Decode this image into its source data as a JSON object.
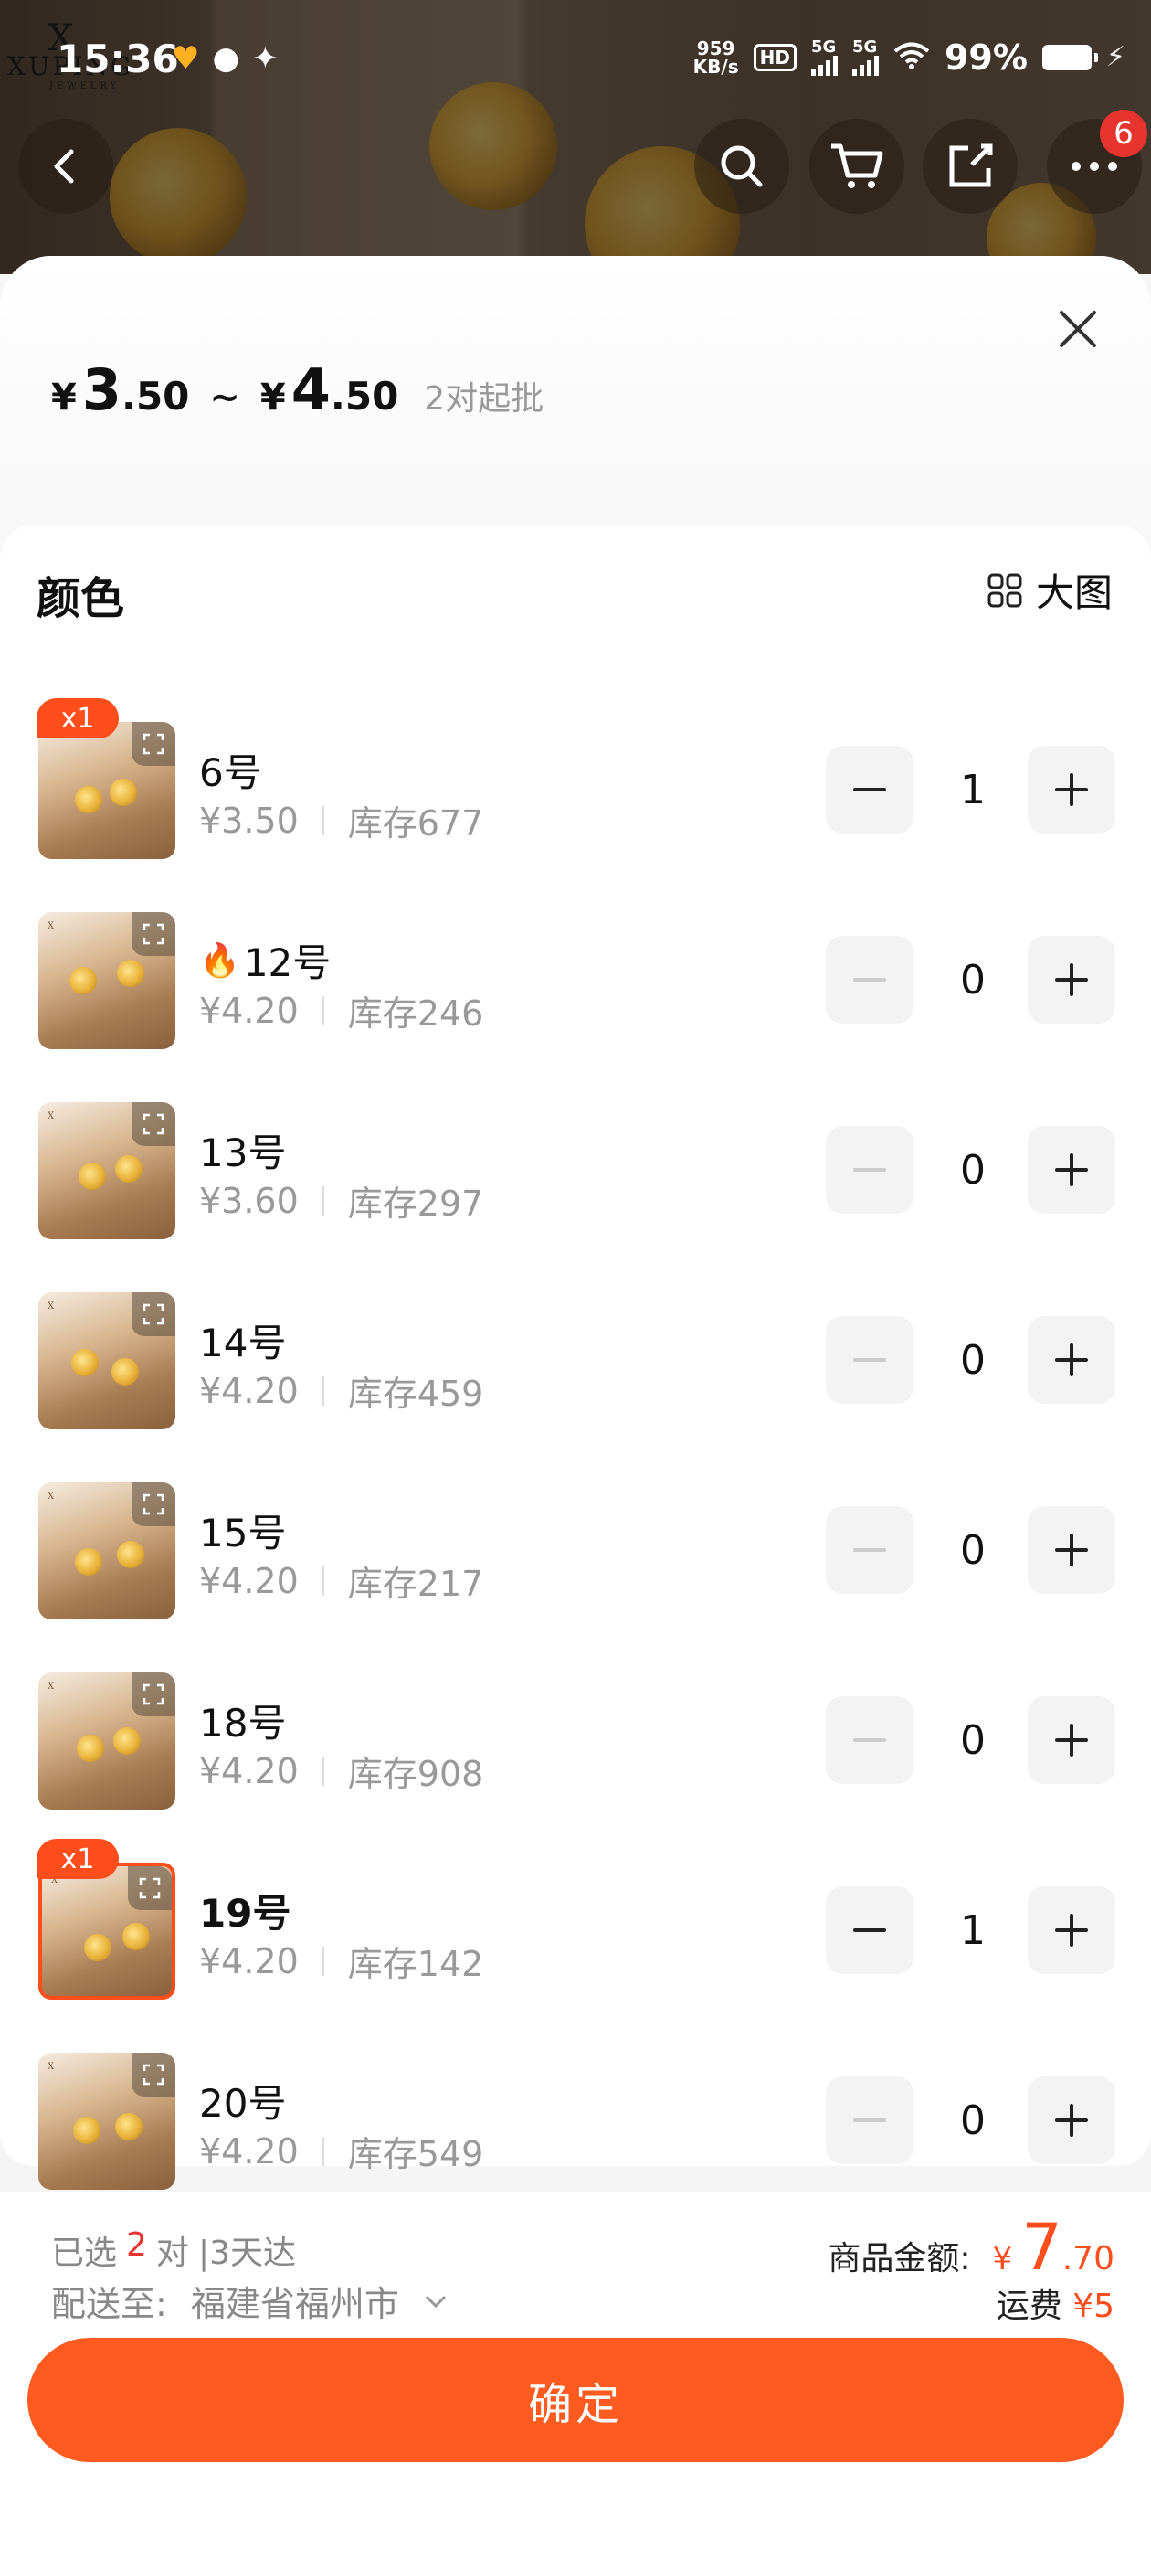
{
  "status_bar": {
    "time": "15:36",
    "net_speed_value": "959",
    "net_speed_unit": "KB/s",
    "hd_badge": "HD",
    "signal_1": "5G",
    "signal_2": "5G",
    "battery": "99%"
  },
  "header": {
    "cart_badge_count": "6",
    "icons": [
      "back-arrow-icon",
      "search-icon",
      "cart-icon",
      "share-icon"
    ]
  },
  "price": {
    "min_currency": "¥",
    "min_int": "3",
    "min_dec": ".50",
    "separator": "~",
    "max_currency": "¥",
    "max_int": "4",
    "max_dec": ".50",
    "moq": "2对起批"
  },
  "section": {
    "title": "颜色",
    "big_view_label": "大图"
  },
  "variants": [
    {
      "name": "6号",
      "price": "¥3.50",
      "stock": "库存677",
      "qty": "1",
      "tag": "x1",
      "hot": false
    },
    {
      "name": "12号",
      "price": "¥4.20",
      "stock": "库存246",
      "qty": "0",
      "tag": "",
      "hot": true
    },
    {
      "name": "13号",
      "price": "¥3.60",
      "stock": "库存297",
      "qty": "0",
      "tag": "",
      "hot": false
    },
    {
      "name": "14号",
      "price": "¥4.20",
      "stock": "库存459",
      "qty": "0",
      "tag": "",
      "hot": false
    },
    {
      "name": "15号",
      "price": "¥4.20",
      "stock": "库存217",
      "qty": "0",
      "tag": "",
      "hot": false
    },
    {
      "name": "18号",
      "price": "¥4.20",
      "stock": "库存908",
      "qty": "0",
      "tag": "",
      "hot": false
    },
    {
      "name": "19号",
      "price": "¥4.20",
      "stock": "库存142",
      "qty": "1",
      "tag": "x1",
      "hot": false
    },
    {
      "name": "20号",
      "price": "¥4.20",
      "stock": "库存549",
      "qty": "0",
      "tag": "",
      "hot": false
    }
  ],
  "footer": {
    "selected_prefix": "已选",
    "selected_count": "2",
    "selected_unit": "对",
    "delivery_eta": "|3天达",
    "ship_to_label": "配送至:",
    "ship_to_value": "福建省福州市",
    "total_label": "商品金额:",
    "total_currency": "¥",
    "total_int": "7",
    "total_dec": ".70",
    "freight_label": "运费",
    "freight_value": "¥5",
    "confirm_label": "确定"
  },
  "colors": {
    "accent": "#ff5a1f",
    "tag": "#ff4d1c",
    "badge_red": "#e8342f",
    "muted_text": "#999999"
  }
}
